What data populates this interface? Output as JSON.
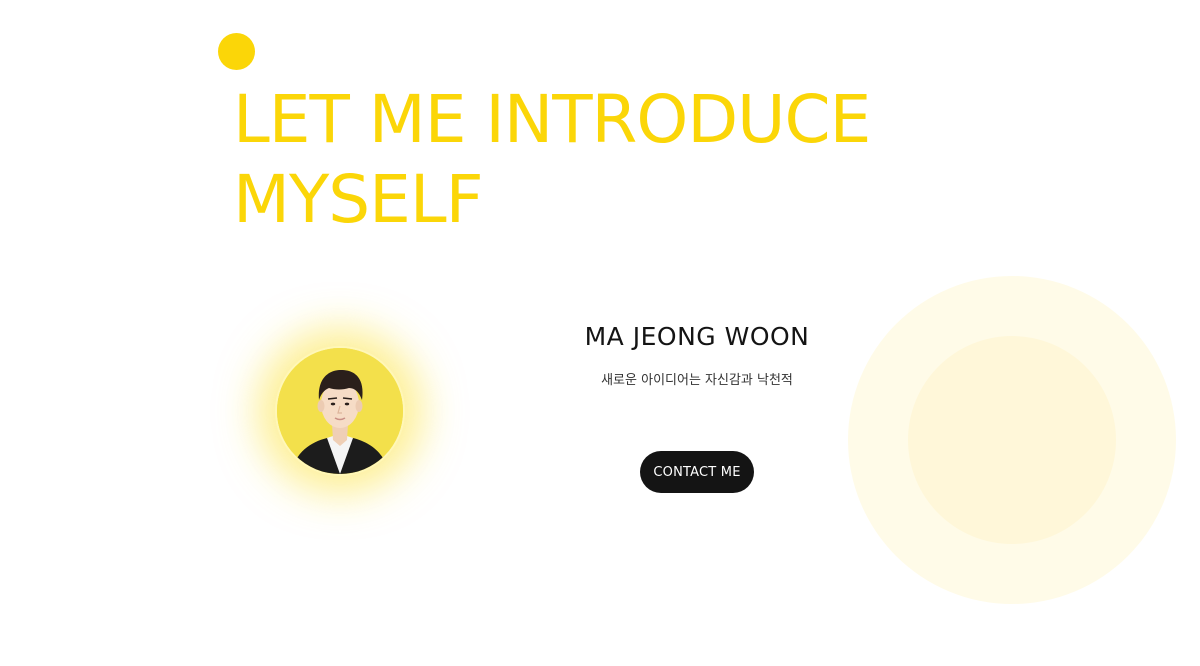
{
  "hero": {
    "headline_line1": "LET ME INTRODUCE",
    "headline_line2": "MYSELF"
  },
  "profile": {
    "name": "MA JEONG WOON",
    "tagline": "새로운 아이디어는 자신감과 낙천적",
    "contact_label": "CONTACT ME",
    "avatar_icon": "profile-photo"
  },
  "colors": {
    "accent": "#fbd608",
    "button_bg": "#141414",
    "soft_circle": "#fffbe8"
  }
}
